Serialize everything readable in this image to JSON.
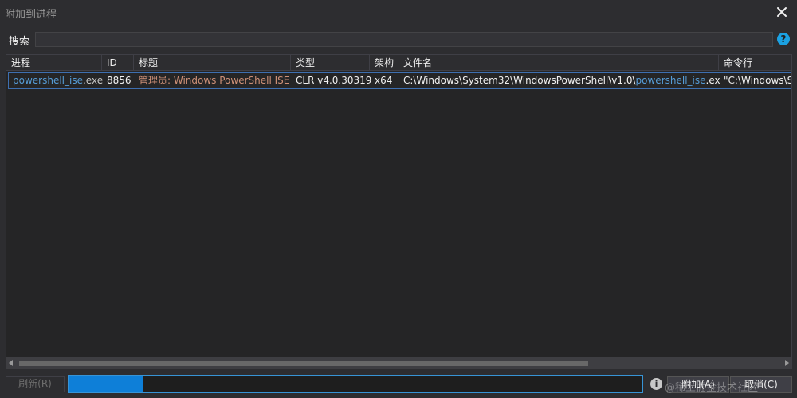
{
  "window": {
    "title": "附加到进程"
  },
  "search": {
    "label": "搜索",
    "value": "",
    "placeholder": ""
  },
  "grid": {
    "columns": [
      "进程",
      "ID",
      "标题",
      "类型",
      "架构",
      "文件名",
      "命令行"
    ],
    "rows": [
      {
        "process_name": "powershell_ise",
        "process_ext": ".exe",
        "id": "8856",
        "title": "管理员: Windows PowerShell ISE",
        "type": "CLR v4.0.30319",
        "arch": "x64",
        "file_prefix": "C:\\Windows\\System32\\WindowsPowerShell\\v1.0\\",
        "file_highlight": "powershell_ise",
        "file_ext": ".exe",
        "command": "\"C:\\Windows\\S"
      }
    ]
  },
  "footer": {
    "refresh_label": "刷新(R)",
    "progress": 0.13,
    "attach_label": "附加(A)",
    "cancel_label": "取消(C)",
    "watermark": "@稀土掘金技术社区"
  },
  "icons": {
    "close": "close-icon",
    "help": "help-icon",
    "info": "info-icon"
  },
  "colors": {
    "accent": "#0e7fd8",
    "help": "#1ba1e2",
    "highlight": "#569cd6",
    "title_text": "#ce9178"
  }
}
